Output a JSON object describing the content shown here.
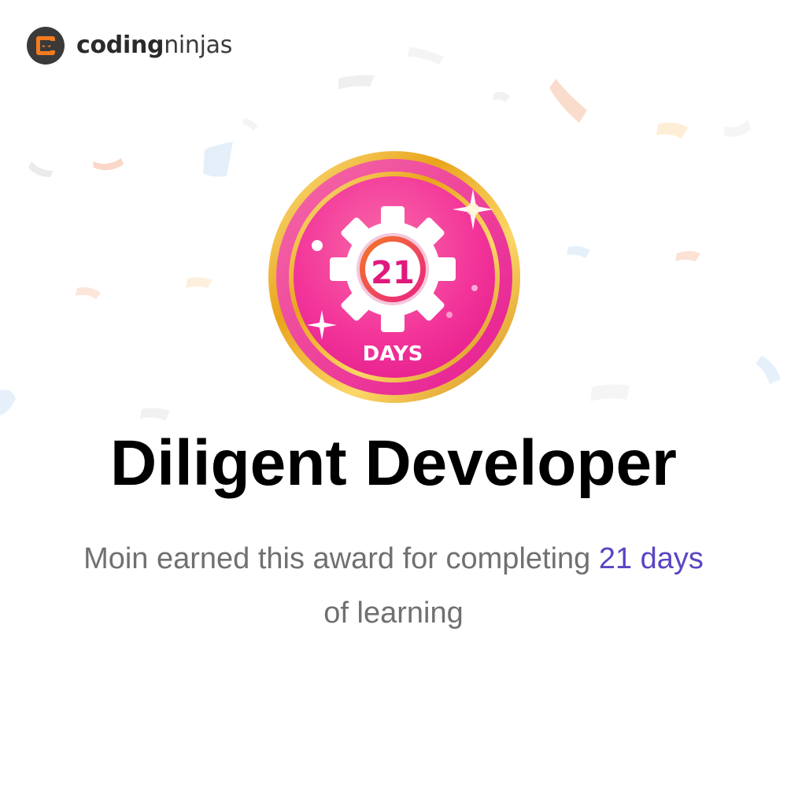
{
  "logo": {
    "name": "coding ninjas",
    "word_bold": "coding",
    "word_light": "ninjas",
    "icon": "ninja-logo-icon",
    "colors": {
      "mark_bg": "#3a3a3a",
      "mark_accent": "#f47b20"
    }
  },
  "badge": {
    "number": "21",
    "unit": "DAYS",
    "icon": "gear-icon",
    "colors": {
      "ring": "#f4b000",
      "face": "#f0289a",
      "number": "#e0197d"
    }
  },
  "award": {
    "title": "Diligent Developer",
    "desc_before": "Moin earned this award for completing",
    "desc_highlight": "21 days",
    "desc_after": "of learning",
    "highlight_color": "#5a45c4"
  }
}
